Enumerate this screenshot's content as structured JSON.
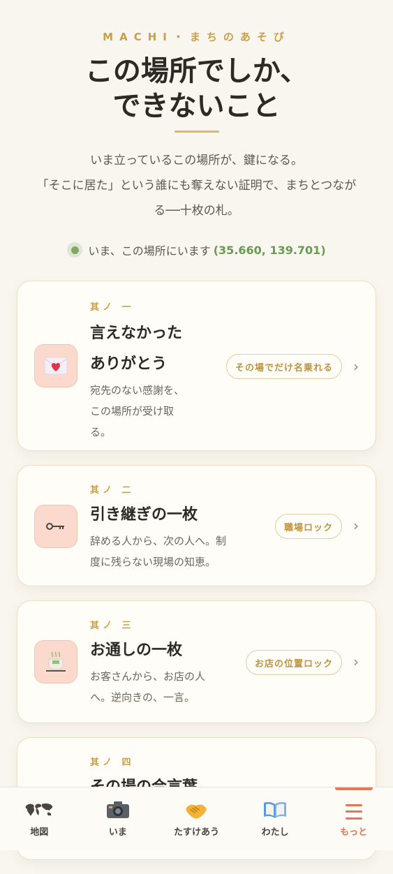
{
  "header": {
    "eyebrow": "MACHI・まちのあそび",
    "title_line1": "この場所でしか、",
    "title_line2": "できないこと",
    "lead_line1": "いま立っているこの場所が、鍵になる。",
    "lead_line2": "「そこに居た」という誰にも奪えない証明で、まちとつなが",
    "lead_line3": "る──十枚の札。"
  },
  "location": {
    "text": "いま、この場所にいます",
    "coords": "(35.660, 139.701)"
  },
  "cards": [
    {
      "no": "其ノ 一",
      "title_line1": "言えなかった",
      "title_line2": "ありがとう",
      "desc_line1": "宛先のない感謝を、",
      "desc_line2": "この場所が受け取",
      "desc_line3": "る。",
      "badge": "その場でだけ名乗れる",
      "icon": "love-letter-icon"
    },
    {
      "no": "其ノ 二",
      "title": "引き継ぎの一枚",
      "desc_line1": "辞める人から、次の人へ。制",
      "desc_line2": "度に残らない現場の知恵。",
      "badge": "職場ロック",
      "icon": "key-icon"
    },
    {
      "no": "其ノ 三",
      "title": "お通しの一枚",
      "desc_line1": "お客さんから、お店の人",
      "desc_line2": "へ。逆向きの、一言。",
      "badge": "お店の位置ロック",
      "icon": "hot-tea-icon"
    },
    {
      "no": "其ノ 四",
      "title": "その場の合言葉",
      "icon": "card-icon"
    }
  ],
  "tabs": [
    {
      "label": "地図",
      "icon": "world-map-icon"
    },
    {
      "label": "いま",
      "icon": "camera-icon"
    },
    {
      "label": "たすけあう",
      "icon": "handshake-icon"
    },
    {
      "label": "わたし",
      "icon": "book-icon"
    },
    {
      "label": "もっと",
      "icon": "menu-icon"
    }
  ],
  "colors": {
    "accent": "#e07656",
    "gold": "#c9a04a",
    "green": "#6b9a54",
    "background": "#f9f6ef"
  }
}
